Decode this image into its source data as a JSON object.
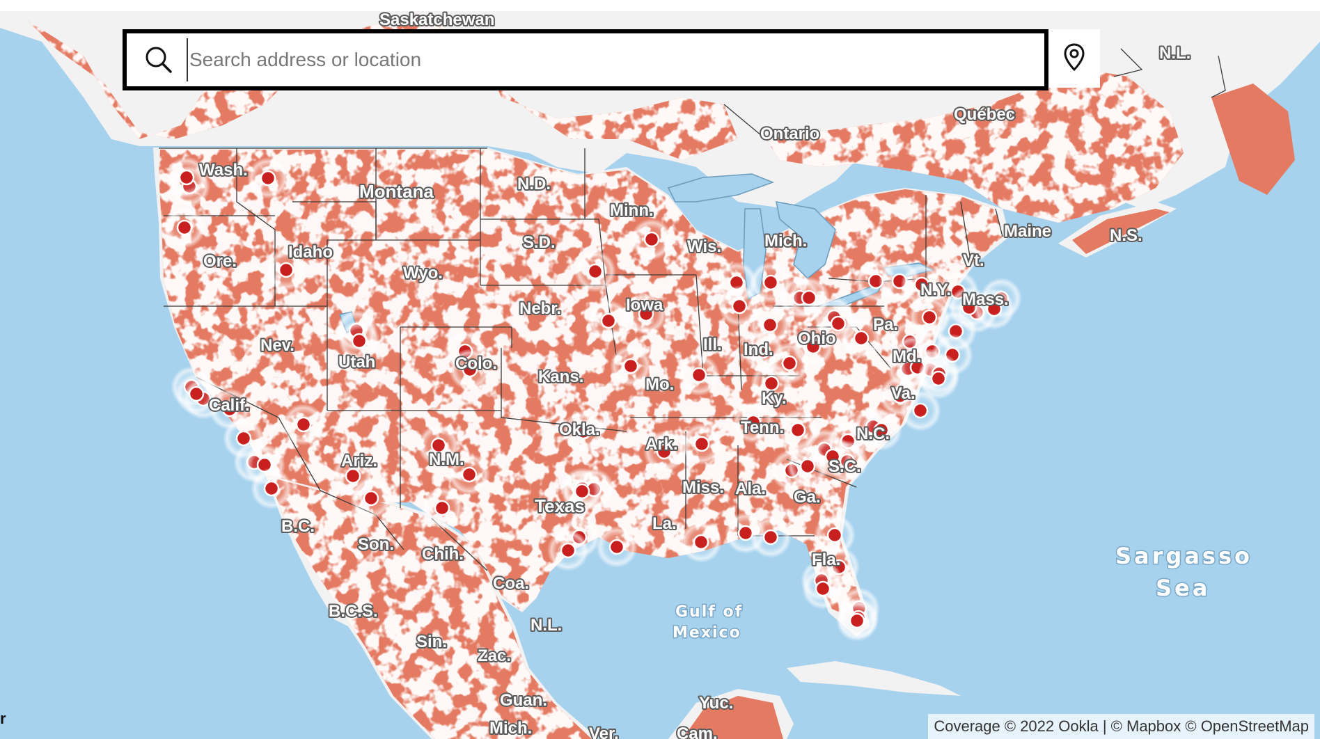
{
  "search": {
    "placeholder": "Search address or location",
    "value": ""
  },
  "icons": {
    "search": "search-icon",
    "locate": "map-pin-icon"
  },
  "attribution": "Coverage © 2022 Ookla | © Mapbox © OpenStreetMap",
  "edge_glyph": "r",
  "colors": {
    "water": "#a6d2ee",
    "land": "#f2f2f2",
    "coverage": "#e47a62",
    "site_marker": "#c8201e",
    "border": "#3a3a3a"
  },
  "map_labels": {
    "saskatchewan": "Saskatchewan",
    "ontario": "Ontario",
    "quebec": "Québec",
    "nl": "N.L.",
    "ns": "N.S.",
    "wash": "Wash.",
    "montana": "Montana",
    "nd": "N.D.",
    "minn": "Minn.",
    "sd": "S.D.",
    "wis": "Wis.",
    "mich": "Mich.",
    "maine": "Maine",
    "vt": "Vt.",
    "ore": "Ore.",
    "idaho": "Idaho",
    "wyo": "Wyo.",
    "nebr": "Nebr.",
    "iowa": "Iowa",
    "ny": "N.Y.",
    "mass": "Mass.",
    "pa": "Pa.",
    "nev": "Nev.",
    "utah": "Utah",
    "colo": "Colo.",
    "ill": "Ill.",
    "ind": "Ind.",
    "ohio": "Ohio",
    "kans": "Kans.",
    "mo": "Mo.",
    "ky": "Ky.",
    "va": "Va.",
    "md": "Md.",
    "calif": "Calif.",
    "okla": "Okla.",
    "ark": "Ark.",
    "tenn": "Tenn.",
    "nc": "N.C.",
    "ariz": "Ariz.",
    "nm": "N.M.",
    "sc": "S.C.",
    "miss": "Miss.",
    "ala": "Ala.",
    "ga": "Ga.",
    "texas": "Texas",
    "la": "La.",
    "bc": "B.C.",
    "son": "Son.",
    "chih": "Chih.",
    "fla": "Fla.",
    "coa": "Coa.",
    "bcs": "B.C.S.",
    "nl_mx": "N.L.",
    "sin": "Sin.",
    "zac": "Zac.",
    "guan": "Guan.",
    "mich_mx": "Mich.",
    "ver": "Ver.",
    "yuc": "Yuc.",
    "cam": "Cam.",
    "gulf_1": "Gulf of",
    "gulf_2": "Mexico",
    "sargasso_1": "Sargasso",
    "sargasso_2": "Sea"
  }
}
